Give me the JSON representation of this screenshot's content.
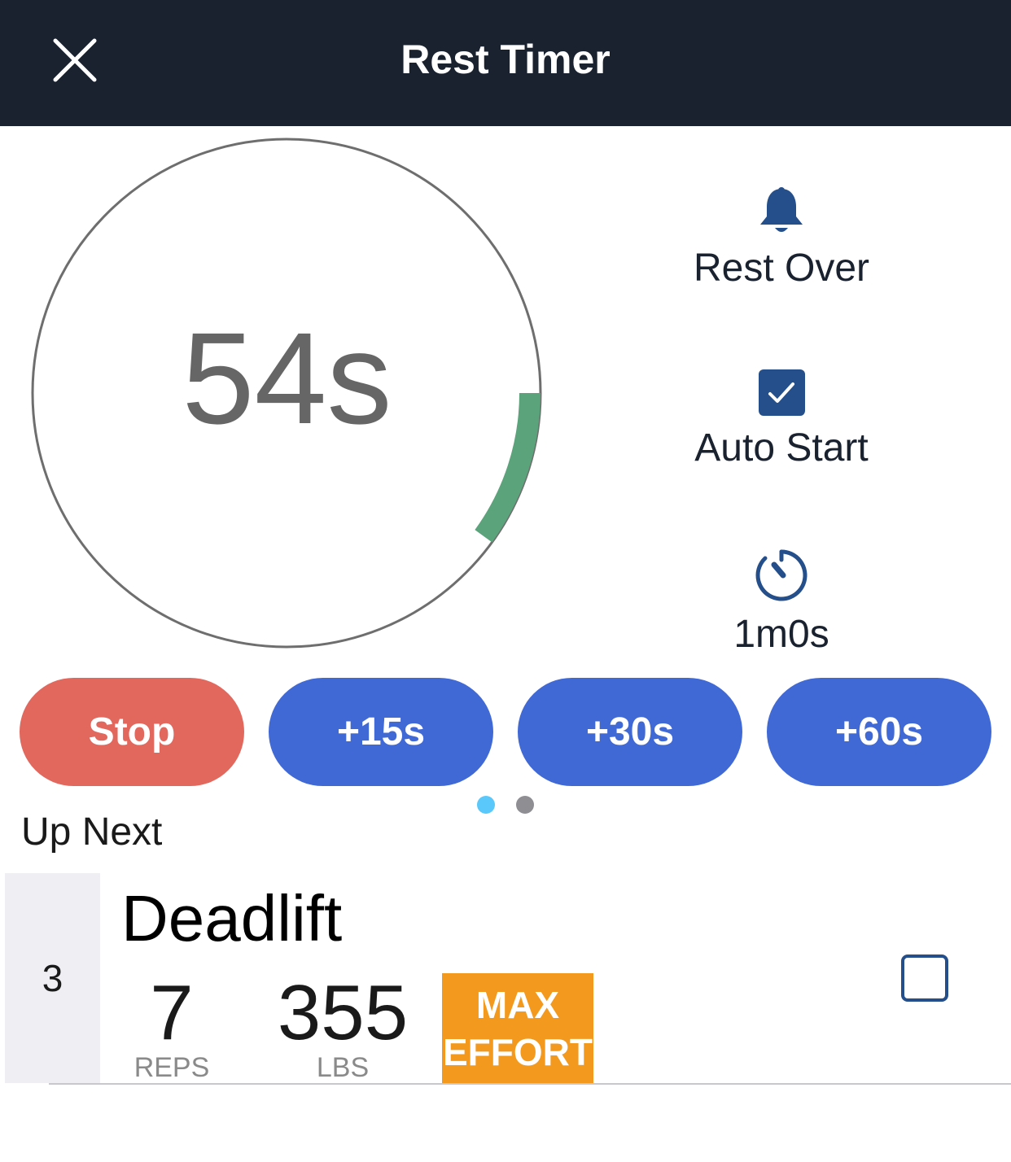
{
  "header": {
    "title": "Rest Timer"
  },
  "timer": {
    "display": "54s",
    "progress_fraction": 0.1,
    "progress_color": "#5ba37b"
  },
  "side": {
    "rest_over_label": "Rest Over",
    "auto_start_label": "Auto Start",
    "auto_start_checked": true,
    "duration_label": "1m0s"
  },
  "buttons": {
    "stop": "Stop",
    "add15": "+15s",
    "add30": "+30s",
    "add60": "+60s"
  },
  "page_dots": {
    "active_color": "#5ac8fa",
    "inactive_color": "#8e8e93",
    "count": 2,
    "active_index": 0
  },
  "up_next": {
    "heading": "Up Next",
    "set_number": "3",
    "exercise": "Deadlift",
    "reps": "7",
    "reps_label": "REPS",
    "weight": "355",
    "weight_label": "LBS",
    "badge_line1": "MAX",
    "badge_line2": "EFFORT",
    "completed": false
  },
  "colors": {
    "header_bg": "#1a2230",
    "stop": "#e2675d",
    "accent_blue": "#4169d6",
    "icon_blue": "#244f8a",
    "badge": "#f39a1e"
  }
}
